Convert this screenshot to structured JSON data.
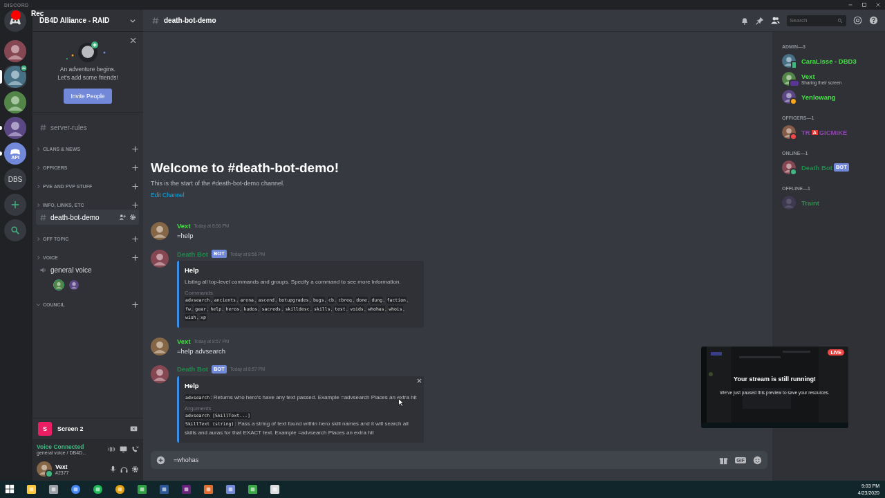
{
  "title_bar": {
    "app_name": "DISCORD"
  },
  "recorder": {
    "label": "Rec"
  },
  "servers": [
    {
      "kind": "home",
      "selected": false,
      "unread": false
    },
    {
      "kind": "picture",
      "selected": false,
      "unread": false
    },
    {
      "kind": "picture",
      "selected": true,
      "unread": false,
      "status_badge": true
    },
    {
      "kind": "picture",
      "selected": false,
      "unread": false
    },
    {
      "kind": "picture",
      "selected": false,
      "unread": true
    },
    {
      "kind": "logo",
      "label": "API",
      "selected": false,
      "unread": true
    },
    {
      "kind": "text",
      "label": "DBS",
      "selected": false,
      "unread": false
    },
    {
      "kind": "add",
      "selected": false,
      "unread": false
    },
    {
      "kind": "search",
      "selected": false,
      "unread": false
    }
  ],
  "server": {
    "name": "DB4D Alliance - RAID"
  },
  "friends_banner": {
    "line1": "An adventure begins.",
    "line2": "Let's add some friends!",
    "button": "Invite People"
  },
  "channels": [
    {
      "kind": "text",
      "name": "server-rules",
      "selected": false
    },
    {
      "kind": "category",
      "name": "CLANS & NEWS",
      "expanded": false
    },
    {
      "kind": "category",
      "name": "OFFICERS",
      "expanded": false
    },
    {
      "kind": "category",
      "name": "PVE AND PVP STUFF",
      "expanded": false
    },
    {
      "kind": "category",
      "name": "INFO, LINKS, ETC",
      "expanded": false
    },
    {
      "kind": "text",
      "name": "death-bot-demo",
      "selected": true
    },
    {
      "kind": "category",
      "name": "OFF TOPIC",
      "expanded": false
    },
    {
      "kind": "category",
      "name": "VOICE",
      "expanded": false
    },
    {
      "kind": "voice",
      "name": "general voice",
      "users": [
        {
          "speaking": true
        },
        {
          "speaking": false
        }
      ]
    },
    {
      "kind": "category",
      "name": "COUNCIL",
      "expanded": true
    }
  ],
  "stream_panel": {
    "initial": "S",
    "label": "Screen 2"
  },
  "voice_panel": {
    "status": "Voice Connected",
    "location": "general voice / DB4D..."
  },
  "user": {
    "name": "Vext",
    "tag": "#2377",
    "status_dot": {
      "kind": "dot",
      "color": "#43b581"
    }
  },
  "channel_header": {
    "name": "death-bot-demo",
    "search_placeholder": "Search"
  },
  "welcome": {
    "title": "Welcome to #death-bot-demo!",
    "subtitle": "This is the start of the #death-bot-demo channel.",
    "link": "Edit Channel"
  },
  "messages": [
    {
      "kind": "user",
      "author": "Vext",
      "color": "#43e043",
      "time": "Today at 8:56 PM",
      "text": "=help"
    },
    {
      "kind": "bot",
      "author": "Death Bot",
      "color": "#1f8b4c",
      "bot_tag": "BOT",
      "time": "Today at 8:56 PM",
      "embed": {
        "title": "Help",
        "closable": false,
        "description": [
          {
            "kind": "text",
            "text": "Listing all top-level commands and groups. Specify a command to see more information."
          }
        ],
        "fields": [
          {
            "kind": "list",
            "name": "Commands",
            "separator": ", ",
            "items": [
              "advsearch",
              "ancients",
              "arena",
              "ascend",
              "botupgrades",
              "bugs",
              "cb",
              "cbreq",
              "done",
              "dung",
              "faction",
              "fw",
              "gear",
              "help",
              "heros",
              "kudos",
              "sacreds",
              "skilldesc",
              "skills",
              "test",
              "voids",
              "whohas",
              "whois",
              "wish",
              "xp"
            ]
          }
        ]
      }
    },
    {
      "kind": "user",
      "author": "Vext",
      "color": "#43e043",
      "time": "Today at 8:57 PM",
      "text": "=help advsearch"
    },
    {
      "kind": "bot",
      "author": "Death Bot",
      "color": "#1f8b4c",
      "bot_tag": "BOT",
      "time": "Today at 8:57 PM",
      "embed": {
        "title": "Help",
        "closable": true,
        "description": [
          {
            "kind": "code",
            "text": "advsearch"
          },
          {
            "kind": "text",
            "text": ": Returns who hero's have any text passed. Example =advsearch Places an extra hit"
          }
        ],
        "fields": [
          {
            "kind": "lines",
            "name": "Arguments",
            "lines": [
              [
                {
                  "kind": "code",
                  "text": "advsearch [SkillText...]"
                }
              ],
              [
                {
                  "kind": "code",
                  "text": "SkillText (string)"
                },
                {
                  "kind": "text",
                  "text": ": Pass a string of text found within hero skill names and it will search all skills and auras for that EXACT text. Example =advsearch Places an extra hit"
                }
              ]
            ]
          }
        ]
      }
    }
  ],
  "composer": {
    "value": "=whohas",
    "gif_label": "GIF"
  },
  "stream_preview": {
    "live_label": "LIVE",
    "title": "Your stream is still running!",
    "text": "We've just paused this preview to save your resources."
  },
  "member_groups": [
    {
      "title": "ADMIN—3",
      "members": [
        {
          "name_parts": [
            {
              "kind": "text",
              "text": "CaraLisse - DBD3"
            }
          ],
          "color": "#43e043",
          "status_dot": {
            "kind": "mobile",
            "color": "#43b581"
          }
        },
        {
          "name_parts": [
            {
              "kind": "text",
              "text": "Vext"
            }
          ],
          "color": "#43e043",
          "status_dot": {
            "kind": "streaming",
            "color": "#593695"
          },
          "activity": "Sharing their screen"
        },
        {
          "name_parts": [
            {
              "kind": "text",
              "text": "Yenlowang"
            }
          ],
          "color": "#43e043",
          "status_dot": {
            "kind": "dot",
            "color": "#faa61a"
          }
        }
      ]
    },
    {
      "title": "OFFICERS—1",
      "members": [
        {
          "name_parts": [
            {
              "kind": "text",
              "text": "TR"
            },
            {
              "kind": "emoji",
              "text": "A"
            },
            {
              "kind": "text",
              "text": "GICMIKE"
            }
          ],
          "color": "#8e44ad",
          "status_dot": {
            "kind": "dot",
            "color": "#f04747"
          }
        }
      ]
    },
    {
      "title": "ONLINE—1",
      "members": [
        {
          "name_parts": [
            {
              "kind": "text",
              "text": "Death Bot"
            }
          ],
          "color": "#1f8b4c",
          "status_dot": {
            "kind": "dot",
            "color": "#43b581"
          },
          "bot_tag": "BOT"
        }
      ]
    },
    {
      "title": "OFFLINE—1",
      "members": [
        {
          "name_parts": [
            {
              "kind": "text",
              "text": "Traint"
            }
          ],
          "color": "#3a8a56",
          "offline": true
        }
      ]
    }
  ],
  "taskbar": {
    "time": "9:03 PM",
    "date": "4/23/2020"
  }
}
